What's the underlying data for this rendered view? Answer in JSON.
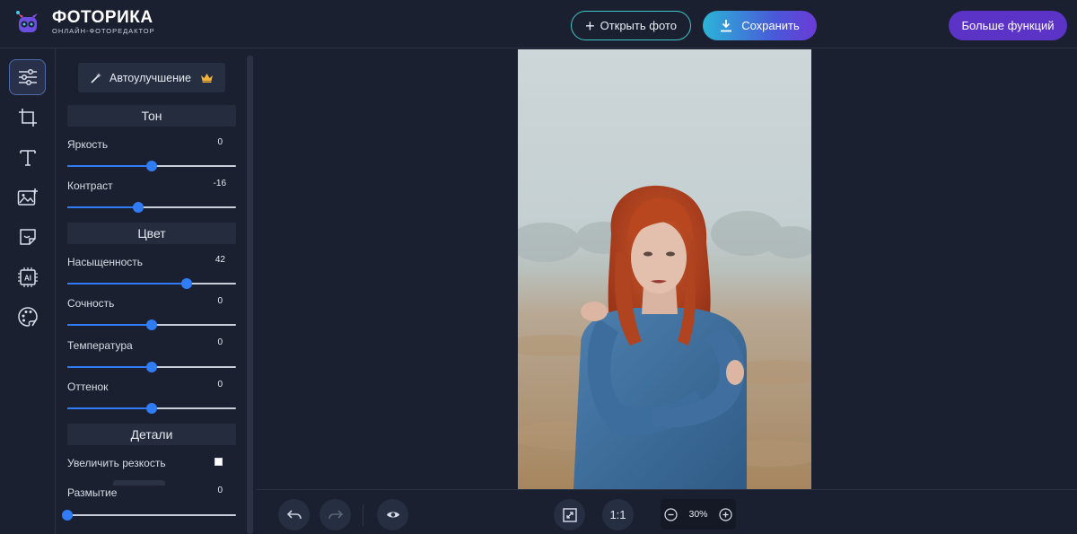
{
  "app": {
    "title": "ФОТОРИКА",
    "subtitle": "ОНЛАЙН-ФОТОРЕДАКТОР"
  },
  "header": {
    "open_label": "Открыть фото",
    "save_label": "Сохранить",
    "more_label": "Больше функций"
  },
  "tools": [
    {
      "icon": "sliders-icon",
      "active": true
    },
    {
      "icon": "crop-icon",
      "active": false
    },
    {
      "icon": "text-icon",
      "active": false
    },
    {
      "icon": "image-add-icon",
      "active": false
    },
    {
      "icon": "sticker-icon",
      "active": false
    },
    {
      "icon": "ai-chip-icon",
      "active": false
    },
    {
      "icon": "palette-icon",
      "active": false
    }
  ],
  "panel": {
    "auto_label": "Автоулучшение",
    "sections": {
      "tone": "Тон",
      "color": "Цвет",
      "details": "Детали"
    },
    "sliders": {
      "brightness": {
        "label": "Яркость",
        "value": "0",
        "position": 0.5
      },
      "contrast": {
        "label": "Контраст",
        "value": "-16",
        "position": 0.42
      },
      "saturation": {
        "label": "Насыщенность",
        "value": "42",
        "position": 0.71
      },
      "vibrance": {
        "label": "Сочность",
        "value": "0",
        "position": 0.5
      },
      "temperature": {
        "label": "Температура",
        "value": "0",
        "position": 0.5
      },
      "tint": {
        "label": "Оттенок",
        "value": "0",
        "position": 0.5
      },
      "blur": {
        "label": "Размытие",
        "value": "0",
        "position": 0.0
      }
    },
    "sharpen_label": "Увеличить резкость",
    "sharpen_checked": false
  },
  "bottombar": {
    "zoom": "30%",
    "actual_size_label": "1:1"
  },
  "colors": {
    "accent": "#2f7cf6",
    "background": "#1b2030",
    "more_button": "#5b33c7"
  }
}
